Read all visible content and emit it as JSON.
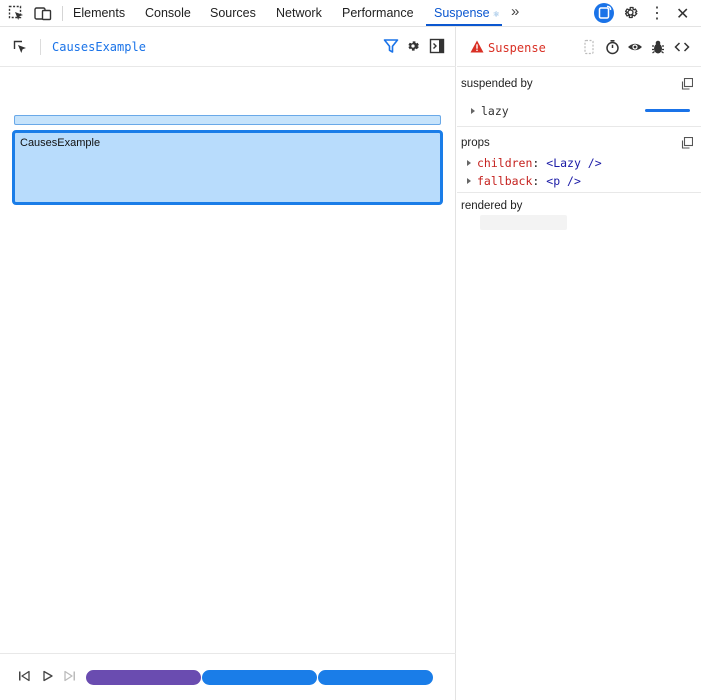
{
  "devtools": {
    "tabs": [
      "Elements",
      "Console",
      "Sources",
      "Network",
      "Performance",
      "Suspense"
    ],
    "active_tab": "Suspense",
    "more_tabs_glyph": "»"
  },
  "left": {
    "root_component": "CausesExample",
    "rect_label": "CausesExample"
  },
  "timeline": {
    "segment_colors": [
      "#6a4cb0",
      "#1a7de8",
      "#1a7de8"
    ]
  },
  "right": {
    "title": "Suspense",
    "suspended_by": {
      "label": "suspended by",
      "items": [
        "lazy"
      ]
    },
    "props": {
      "label": "props",
      "items": [
        {
          "key": "children",
          "sep": ":",
          "value": "<Lazy />"
        },
        {
          "key": "fallback",
          "sep": ":",
          "value": "<p />"
        }
      ]
    },
    "rendered_by": {
      "label": "rendered by"
    }
  },
  "colors": {
    "accent": "#1a73e8",
    "warning": "#d93025",
    "prop_key": "#c5221f",
    "prop_value": "#1a1aa6"
  }
}
